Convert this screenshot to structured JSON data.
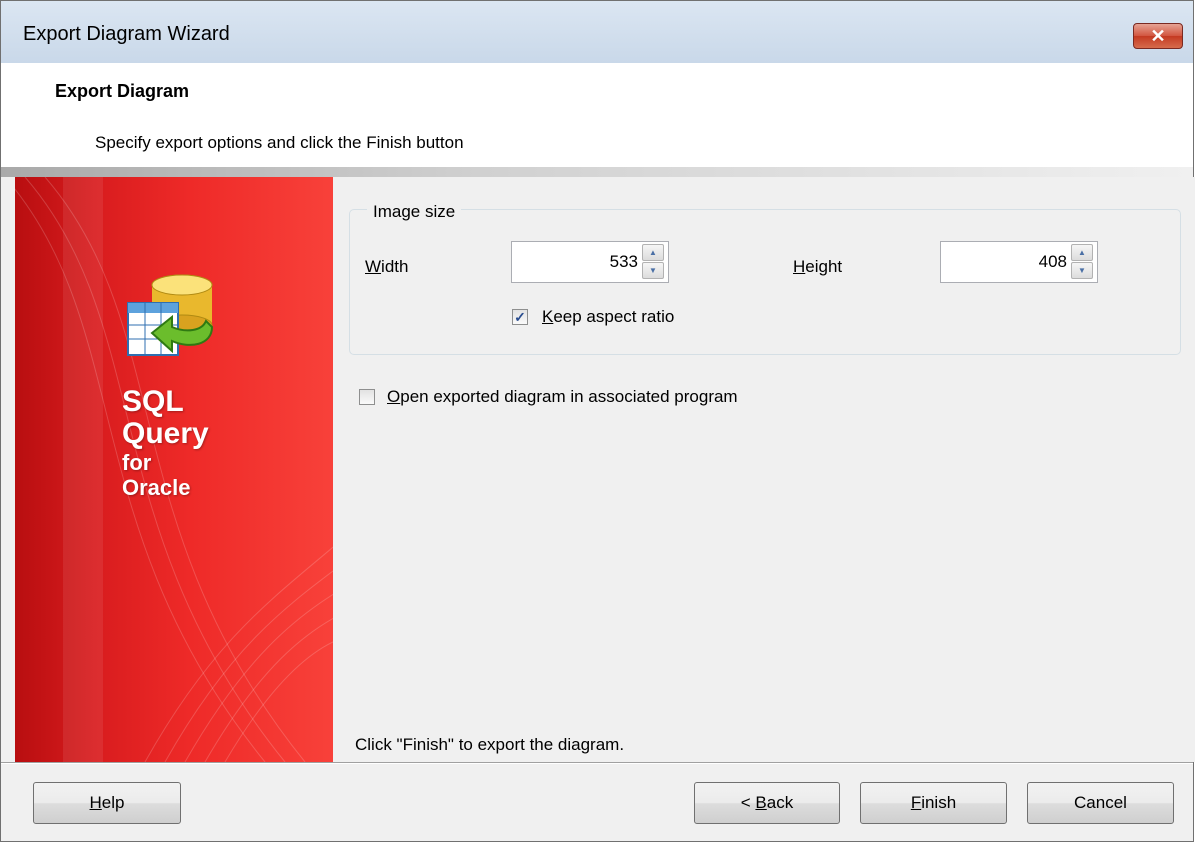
{
  "window": {
    "title": "Export Diagram Wizard",
    "close_label": "✕"
  },
  "header": {
    "title": "Export Diagram",
    "subtitle": "Specify export options and click the Finish button"
  },
  "banner": {
    "line1": "SQL",
    "line2": "Query",
    "line3": "for",
    "line4": "Oracle",
    "icon": "database-export-icon"
  },
  "image_size": {
    "legend": "Image size",
    "width_label_access": "W",
    "width_label_rest": "idth",
    "width_value": "533",
    "height_label_access": "H",
    "height_label_rest": "eight",
    "height_value": "408",
    "keep_aspect_access": "K",
    "keep_aspect_rest": "eep aspect ratio",
    "keep_aspect_checked": true
  },
  "open_exported": {
    "label_access": "O",
    "label_rest": "pen exported diagram in associated program",
    "checked": false
  },
  "hint": "Click \"Finish\" to export the diagram.",
  "buttons": {
    "help_access": "H",
    "help_rest": "elp",
    "back_prefix": "< ",
    "back_access": "B",
    "back_rest": "ack",
    "finish_access": "F",
    "finish_rest": "inish",
    "cancel": "Cancel"
  },
  "colors": {
    "banner_red": "#e8232a",
    "titlebar": "#d4e1f0"
  }
}
